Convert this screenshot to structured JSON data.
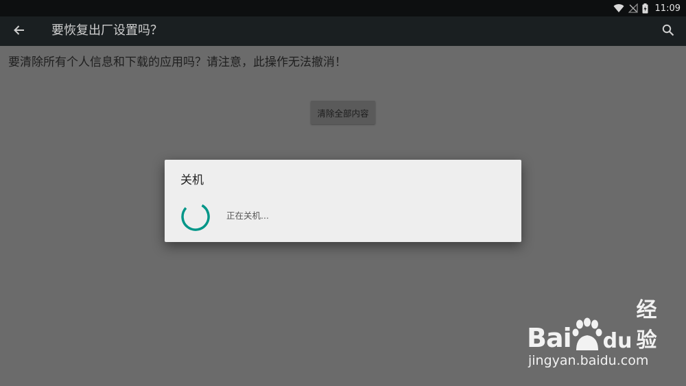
{
  "status_bar": {
    "time": "11:09",
    "icons": [
      "wifi-icon",
      "no-signal-icon",
      "battery-icon"
    ]
  },
  "action_bar": {
    "back_icon": "arrow-left-icon",
    "title": "要恢复出厂设置吗？",
    "search_icon": "search-icon"
  },
  "content": {
    "message": "要清除所有个人信息和下载的应用吗？请注意，此操作无法撤消！",
    "clear_button_label": "清除全部内容"
  },
  "dialog": {
    "title": "关机",
    "message": "正在关机...",
    "spinner_color": "#009688"
  },
  "watermark": {
    "logo_text_left": "Bai",
    "logo_text_du": "du",
    "logo_text_right": "经验",
    "url": "jingyan.baidu.com"
  },
  "colors": {
    "status_bar": "#0d0f10",
    "action_bar": "#1a1f21",
    "background_dim": "#6b6b6b",
    "dialog_bg": "#eeeeee"
  }
}
